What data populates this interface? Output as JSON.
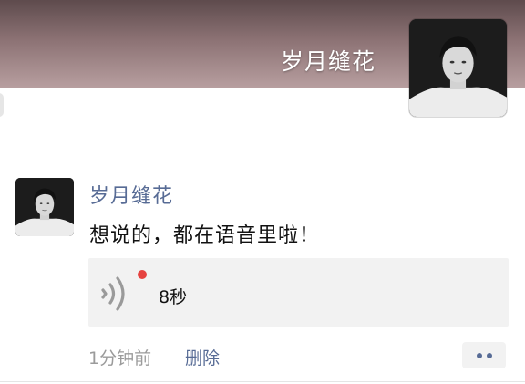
{
  "cover": {
    "name": "岁月缝花"
  },
  "post": {
    "author": "岁月缝花",
    "text": "想说的，都在语音里啦！",
    "voice": {
      "duration": "8秒",
      "unread": true
    },
    "time": "1分钟前",
    "delete_label": "删除"
  },
  "icons": {
    "avatar": "avatar-photo-icon",
    "voice": "voice-waves-icon",
    "more": "more-dots-icon"
  },
  "colors": {
    "link": "#576b95",
    "secondary_text": "#9b9b9b",
    "voice_card_bg": "#f2f2f2",
    "unread_dot": "#e64340"
  }
}
